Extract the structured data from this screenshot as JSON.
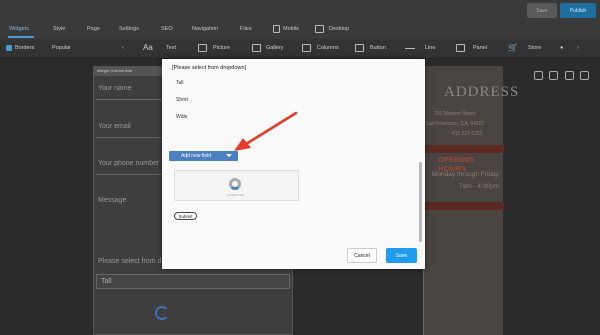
{
  "topbar": {
    "save_label": "Save",
    "publish_label": "Publish"
  },
  "tabs": [
    "Widgets",
    "Style",
    "Page",
    "Settings",
    "SEO",
    "Navigation",
    "Files",
    "Mobile",
    "Desktop"
  ],
  "toolbar": {
    "borders_label": "Borders",
    "popular_label": "Popular",
    "items": [
      "Text",
      "Picture",
      "Gallery",
      "Columns",
      "Button",
      "Line",
      "Panel",
      "Store"
    ]
  },
  "form": {
    "header_text": "Margin  Column  Add",
    "fields": [
      "Your name",
      "Your email",
      "Your phone number",
      "Message",
      "Please select from d"
    ],
    "select_value": "Tall"
  },
  "right_panel": {
    "address_title": "ADDRESS",
    "address_lines": [
      "201 Mission Street",
      "San Francisco, CA, 94107",
      "415 227 0250"
    ],
    "hours_title": "OPENING HOURS",
    "hours_lines": [
      "Monday through Friday",
      "7am - 4:30pm"
    ]
  },
  "modal": {
    "select_placeholder": "[Please select from dropdown]",
    "options": [
      "Tall",
      "Short",
      "Wide"
    ],
    "add_field_label": "Add new field",
    "captcha_label": "reCAPTCHA",
    "submit_label": "Submit",
    "cancel_label": "Cancel",
    "save_label": "Save"
  },
  "colors": {
    "accent": "#1e9df0",
    "arrow": "#e8392a",
    "add_field": "#4a7fc1"
  }
}
